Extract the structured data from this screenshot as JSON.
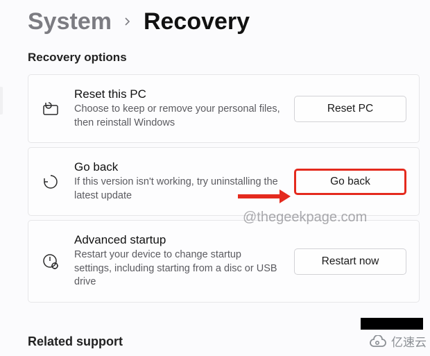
{
  "breadcrumb": {
    "root": "System",
    "leaf": "Recovery"
  },
  "section_title": "Recovery options",
  "options": [
    {
      "icon": "reset-pc-icon",
      "title": "Reset this PC",
      "desc": "Choose to keep or remove your personal files, then reinstall Windows",
      "button": "Reset PC"
    },
    {
      "icon": "go-back-icon",
      "title": "Go back",
      "desc": "If this version isn't working, try uninstalling the latest update",
      "button": "Go back"
    },
    {
      "icon": "advanced-startup-icon",
      "title": "Advanced startup",
      "desc": "Restart your device to change startup settings, including starting from a disc or USB drive",
      "button": "Restart now"
    }
  ],
  "annotation": {
    "highlight_index": 1,
    "color": "#e42a1e"
  },
  "watermark": "@thegeekpage.com",
  "related_title": "Related support",
  "vendor_badge": "亿速云"
}
